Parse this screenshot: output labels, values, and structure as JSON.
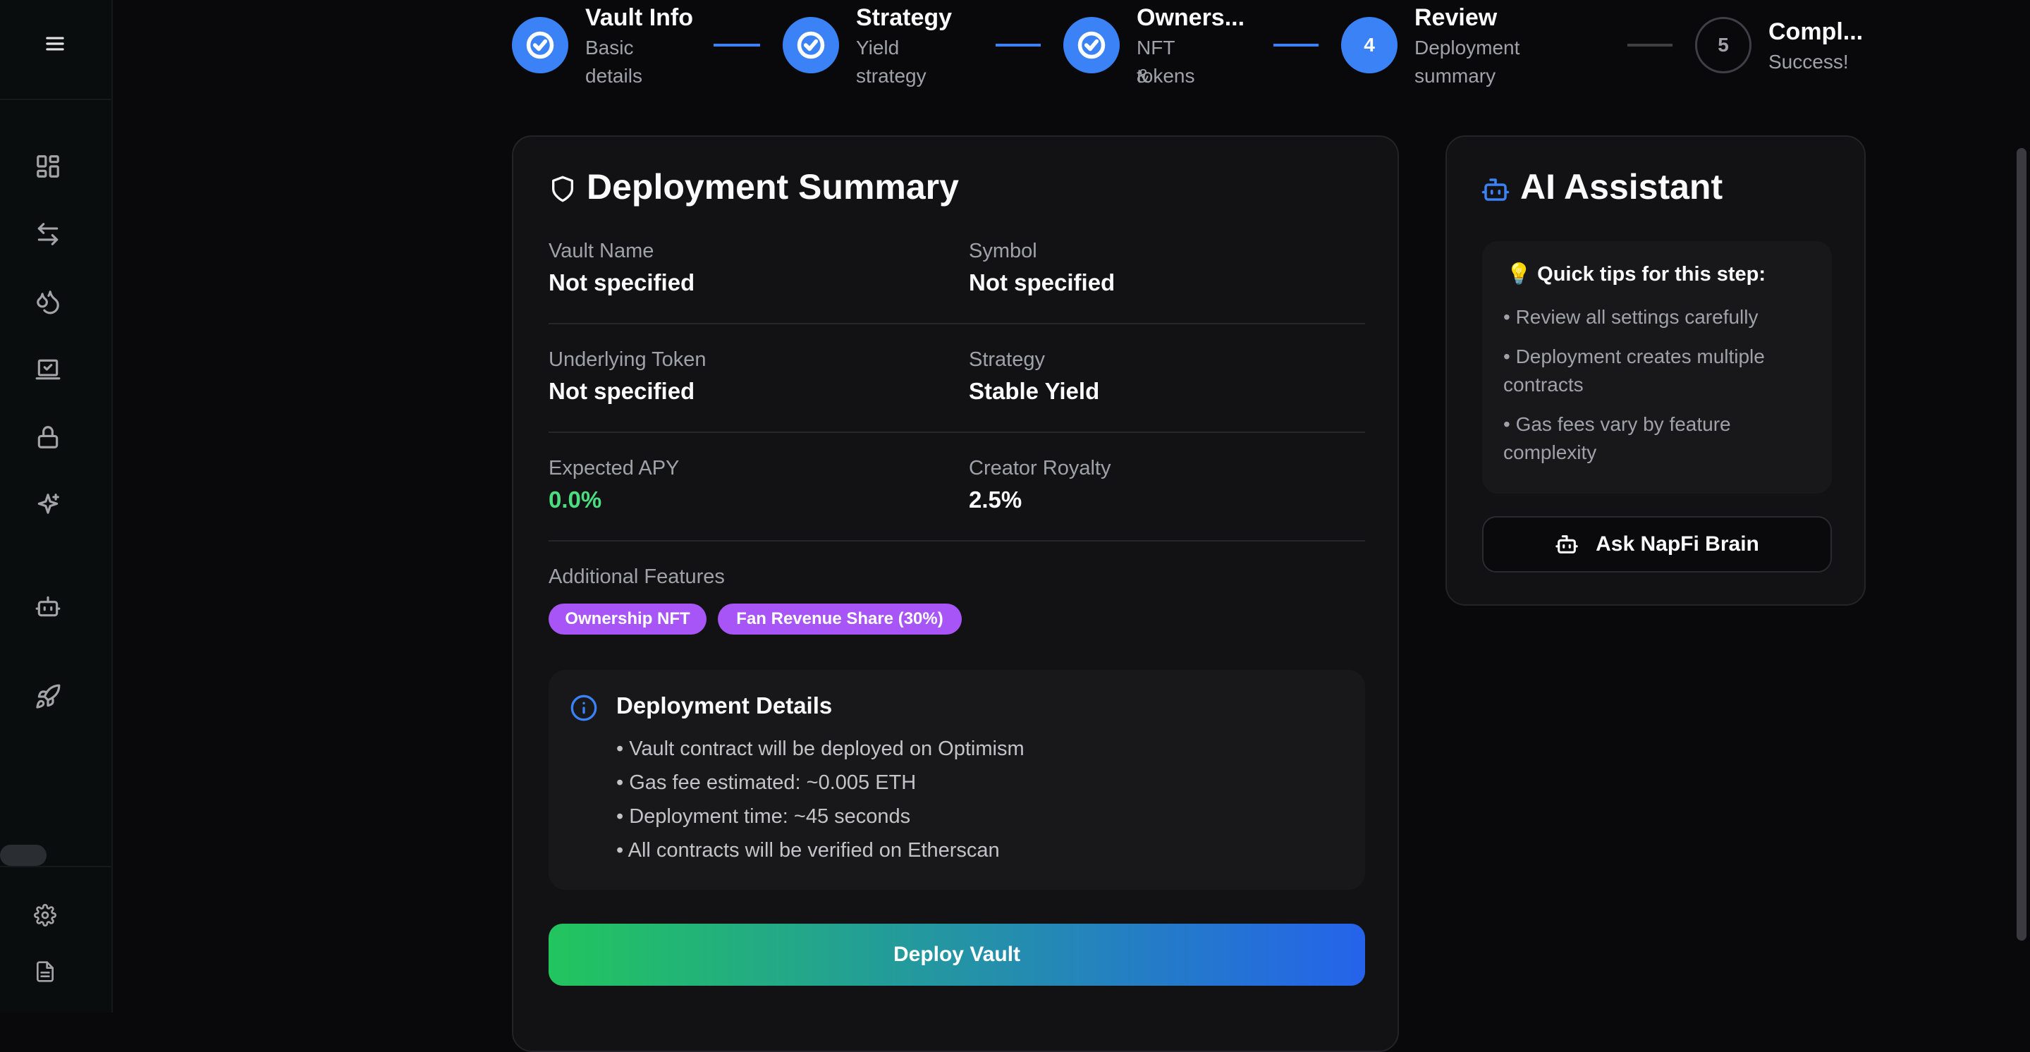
{
  "sidebar": {
    "items": [
      "menu-icon",
      "dashboard-icon",
      "swap-icon",
      "flame-icon",
      "checklist-icon",
      "lock-icon",
      "sparkles-icon",
      "bot-icon",
      "rocket-icon",
      "gear-icon",
      "document-icon"
    ]
  },
  "stepper": {
    "steps": [
      {
        "title": "Vault Info",
        "sub1": "Basic",
        "sub2": "details",
        "state": "done"
      },
      {
        "title": "Strategy",
        "sub1": "Yield",
        "sub2": "strategy",
        "state": "done"
      },
      {
        "title": "Owners...",
        "sub1": "NFT &",
        "sub2": "tokens",
        "state": "done"
      },
      {
        "title": "Review",
        "number": "4",
        "sub1": "Deployment",
        "sub2": "summary",
        "state": "active"
      },
      {
        "title": "Compl...",
        "number": "5",
        "sub1": "Success!",
        "state": "pending"
      }
    ]
  },
  "summary": {
    "title": "Deployment Summary",
    "fields": {
      "vault_name_label": "Vault Name",
      "vault_name_value": "Not specified",
      "symbol_label": "Symbol",
      "symbol_value": "Not specified",
      "token_label": "Underlying Token",
      "token_value": "Not specified",
      "strategy_label": "Strategy",
      "strategy_value": "Stable Yield",
      "apy_label": "Expected APY",
      "apy_value": "0.0%",
      "royalty_label": "Creator Royalty",
      "royalty_value": "2.5%"
    },
    "features_label": "Additional Features",
    "features": [
      "Ownership NFT",
      "Fan Revenue Share (30%)"
    ],
    "details": {
      "title": "Deployment Details",
      "items": [
        "• Vault contract will be deployed on Optimism",
        "• Gas fee estimated: ~0.005 ETH",
        "• Deployment time: ~45 seconds",
        "• All contracts will be verified on Etherscan"
      ]
    },
    "deploy_label": "Deploy Vault"
  },
  "assistant": {
    "title": "AI Assistant",
    "tips_title": "💡 Quick tips for this step:",
    "tips": [
      "• Review all settings carefully",
      "• Deployment creates multiple contracts",
      "• Gas fees vary by feature complexity"
    ],
    "ask_label": "Ask NapFi Brain"
  },
  "colors": {
    "accent": "#3b82f6",
    "success": "#4ade80",
    "badge": "#a855f7",
    "background": "#09090b"
  }
}
